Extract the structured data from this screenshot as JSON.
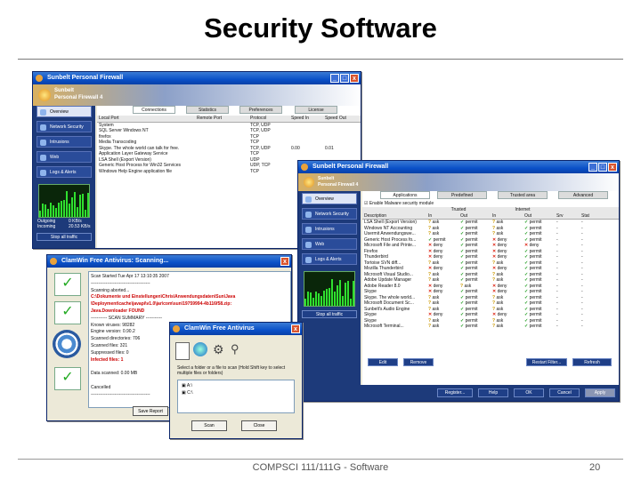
{
  "slide": {
    "title": "Security Software",
    "footer": "COMPSCI 111/111G - Software",
    "page_number": "20"
  },
  "firewall_back": {
    "title": "Sunbelt Personal Firewall",
    "brand_line1": "Sunbelt",
    "brand_line2": "Personal Firewall 4",
    "tabs": [
      "Connections",
      "Statistics",
      "Preferences",
      "License"
    ],
    "columns": [
      "Local Port",
      "Remote Port",
      "Protocol",
      "Speed In",
      "Speed Out"
    ],
    "rows": [
      {
        "name": "System",
        "protocol": "TCP, UDP",
        "speed_in": "",
        "speed_out": ""
      },
      {
        "name": "SQL Server Windows NT",
        "protocol": "TCP, UDP",
        "speed_in": "",
        "speed_out": ""
      },
      {
        "name": "firefox",
        "protocol": "TCP",
        "speed_in": "",
        "speed_out": ""
      },
      {
        "name": "Media Transcoding",
        "protocol": "TCP",
        "speed_in": "",
        "speed_out": ""
      },
      {
        "name": "Skype. The whole world can talk for free.",
        "protocol": "TCP, UDP",
        "speed_in": "0.00",
        "speed_out": "0.01"
      },
      {
        "name": "Application Layer Gateway Service",
        "protocol": "TCP",
        "speed_in": "",
        "speed_out": ""
      },
      {
        "name": "LSA Shell (Export Version)",
        "protocol": "UDP",
        "speed_in": "",
        "speed_out": ""
      },
      {
        "name": "Generic Host Process for Win32 Services",
        "protocol": "UDP, TCP",
        "speed_in": "",
        "speed_out": ""
      },
      {
        "name": "Windows Help Engine application file",
        "protocol": "TCP",
        "speed_in": "",
        "speed_out": ""
      }
    ],
    "nav": [
      "Overview",
      "Network Security",
      "Intrusions",
      "Web",
      "Logs & Alerts"
    ],
    "graph_labels": [
      "Outgoing",
      "Incoming"
    ],
    "graph_values": [
      "0 KB/s",
      "20.53 KB/s"
    ],
    "stop_button": "Stop all traffic"
  },
  "firewall_front": {
    "title": "Sunbelt Personal Firewall",
    "brand_line1": "Sunbelt",
    "brand_line2": "Personal Firewall 4",
    "tabs": [
      "Applications",
      "Predefined",
      "Trusted area",
      "Advanced"
    ],
    "nav": [
      "Overview",
      "Network Security",
      "Intrusions",
      "Web",
      "Logs & Alerts"
    ],
    "enable_label": "Enable Malware security module",
    "group_headers": [
      "Trusted",
      "Internet"
    ],
    "columns": [
      "Description",
      "In",
      "Out",
      "In",
      "Out",
      "Srv",
      "Stat"
    ],
    "rows": [
      {
        "name": "LSA Shell (Export Version)",
        "t_in": "ask",
        "t_out": "permit",
        "i_in": "ask",
        "i_out": "permit"
      },
      {
        "name": "Windows NT Accounting",
        "t_in": "ask",
        "t_out": "permit",
        "i_in": "ask",
        "i_out": "permit"
      },
      {
        "name": "Usermit Anwendungswe...",
        "t_in": "ask",
        "t_out": "permit",
        "i_in": "ask",
        "i_out": "permit"
      },
      {
        "name": "Generic Host Process fo...",
        "t_in": "permit",
        "t_out": "permit",
        "i_in": "deny",
        "i_out": "permit"
      },
      {
        "name": "Microsoft File and Printe...",
        "t_in": "deny",
        "t_out": "permit",
        "i_in": "deny",
        "i_out": "deny"
      },
      {
        "name": "Firefox",
        "t_in": "deny",
        "t_out": "permit",
        "i_in": "deny",
        "i_out": "permit"
      },
      {
        "name": "Thunderbird",
        "t_in": "deny",
        "t_out": "permit",
        "i_in": "deny",
        "i_out": "permit"
      },
      {
        "name": "Tortoise SVN diff...",
        "t_in": "ask",
        "t_out": "permit",
        "i_in": "ask",
        "i_out": "permit"
      },
      {
        "name": "Mozilla Thunderbird",
        "t_in": "deny",
        "t_out": "permit",
        "i_in": "deny",
        "i_out": "permit"
      },
      {
        "name": "Microsoft Visual Studio...",
        "t_in": "ask",
        "t_out": "permit",
        "i_in": "ask",
        "i_out": "permit"
      },
      {
        "name": "Adobe Update Manager",
        "t_in": "ask",
        "t_out": "permit",
        "i_in": "ask",
        "i_out": "permit"
      },
      {
        "name": "Adobe Reader 8.0",
        "t_in": "deny",
        "t_out": "ask",
        "i_in": "deny",
        "i_out": "permit"
      },
      {
        "name": "Skype",
        "t_in": "deny",
        "t_out": "permit",
        "i_in": "deny",
        "i_out": "permit"
      },
      {
        "name": "Skype. The whole world...",
        "t_in": "ask",
        "t_out": "permit",
        "i_in": "ask",
        "i_out": "permit"
      },
      {
        "name": "Microsoft Document Sc...",
        "t_in": "ask",
        "t_out": "permit",
        "i_in": "ask",
        "i_out": "permit"
      },
      {
        "name": "Sunbelt's Audio Engine",
        "t_in": "ask",
        "t_out": "permit",
        "i_in": "ask",
        "i_out": "permit"
      },
      {
        "name": "Skype",
        "t_in": "deny",
        "t_out": "permit",
        "i_in": "deny",
        "i_out": "permit"
      },
      {
        "name": "Skype",
        "t_in": "ask",
        "t_out": "permit",
        "i_in": "ask",
        "i_out": "permit"
      },
      {
        "name": "Microsoft Terminal...",
        "t_in": "ask",
        "t_out": "permit",
        "i_in": "ask",
        "i_out": "permit"
      }
    ],
    "edit_button": "Edit",
    "remove_button": "Remove",
    "restart_button": "Restart Filter...",
    "refresh_button": "Refresh",
    "register_button": "Register...",
    "help_button": "Help",
    "ok_button": "OK",
    "cancel_button": "Cancel",
    "apply_button": "Apply",
    "stop_button": "Stop all traffic"
  },
  "clamwin_scan": {
    "title": "ClamWin Free Antivirus: Scanning...",
    "log_lines": [
      "Scan Started Tue Apr 17 13:10:35 2007",
      "----------------------------------------",
      "Scanning aborted...",
      "C:\\Dokumente und Einstellungen\\Chris\\Anwendungsdaten\\Sun\\Java",
      "\\Deployment\\cache\\javapi\\v1.0\\jar\\com\\sun\\19759994-4b116f58.zip:",
      "Java.Downloader FOUND",
      "----------- SCAN SUMMARY -----------",
      "Known viruses: 98282",
      "Engine version: 0.90.2",
      "Scanned directories: 706",
      "Scanned files: 321",
      "Suppressed files: 0",
      "Infected files: 1",
      "",
      "Data scanned: 0.00 MB",
      "",
      "Cancelled",
      "----------------------------------------"
    ],
    "save_button": "Save Report"
  },
  "clamwin_main": {
    "title": "ClamWin Free Antivirus",
    "instruction": "Select a folder or a file to scan (Hold Shift key to select multiple files or folders)",
    "tree_items": [
      "A:\\",
      "C:\\"
    ],
    "scan_button": "Scan",
    "close_button": "Close"
  }
}
